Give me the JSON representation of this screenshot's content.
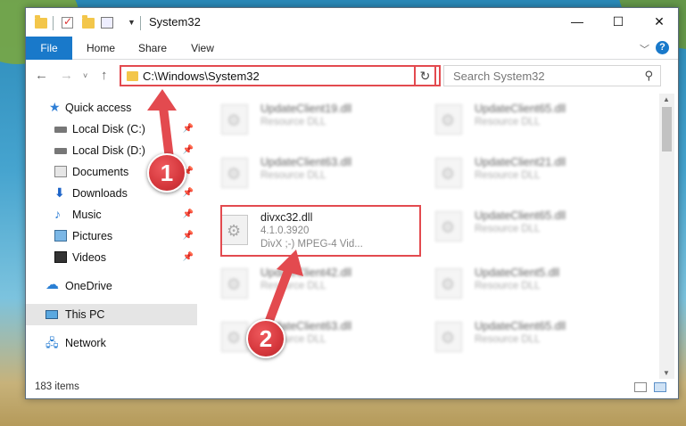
{
  "window": {
    "title": "System32",
    "controls": [
      "minimize-icon",
      "maximize-icon",
      "close-icon"
    ]
  },
  "ribbon": {
    "tabs": [
      "File",
      "Home",
      "Share",
      "View"
    ]
  },
  "address": {
    "path": "C:\\Windows\\System32",
    "search_placeholder": "Search System32"
  },
  "nav": {
    "quick_access": "Quick access",
    "items": [
      {
        "label": "Local Disk (C:)",
        "icon": "drive-icon",
        "pinned": true
      },
      {
        "label": "Local Disk (D:)",
        "icon": "drive-icon",
        "pinned": true
      },
      {
        "label": "Documents",
        "icon": "documents-icon",
        "pinned": true
      },
      {
        "label": "Downloads",
        "icon": "downloads-icon",
        "pinned": true
      },
      {
        "label": "Music",
        "icon": "music-icon",
        "pinned": true
      },
      {
        "label": "Pictures",
        "icon": "pictures-icon",
        "pinned": true
      },
      {
        "label": "Videos",
        "icon": "videos-icon",
        "pinned": true
      }
    ],
    "onedrive": "OneDrive",
    "this_pc": "This PC",
    "network": "Network"
  },
  "files": {
    "left_column": [
      {
        "name": "UpdateClient19.dll",
        "desc": "Resource DLL"
      },
      {
        "name": "UpdateClient63.dll",
        "desc": "Resource DLL"
      },
      {
        "name": "divxc32.dll",
        "version": "4.1.0.3920",
        "desc": "DivX ;-) MPEG-4 Vid..."
      },
      {
        "name": "UpdateClient42.dll",
        "desc": "Resource DLL"
      },
      {
        "name": "UpdateClient63.dll",
        "desc": "Resource DLL"
      }
    ],
    "right_column": [
      {
        "name": "UpdateClient65.dll",
        "desc": "Resource DLL"
      },
      {
        "name": "UpdateClient21.dll",
        "desc": "Resource DLL"
      },
      {
        "name": "UpdateClient65.dll",
        "desc": "Resource DLL"
      },
      {
        "name": "UpdateClient5.dll",
        "desc": "Resource DLL"
      },
      {
        "name": "UpdateClient65.dll",
        "desc": "Resource DLL"
      }
    ]
  },
  "status": {
    "item_count": "183 items"
  },
  "annotations": {
    "step1": "1",
    "step2": "2",
    "accent": "#e34a4f"
  }
}
